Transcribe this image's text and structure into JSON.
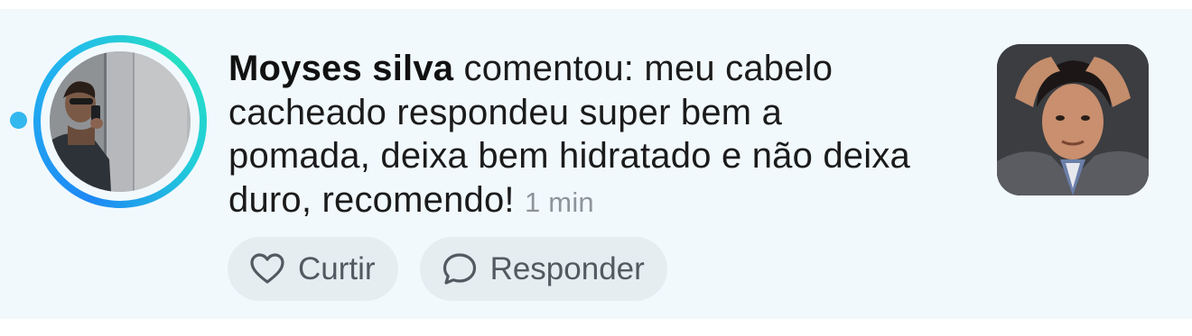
{
  "comment": {
    "author": "Moyses silva",
    "text": " comentou: meu cabelo cacheado respondeu super bem a pomada, deixa bem hidratado e não deixa duro, recomendo!",
    "time": "1 min"
  },
  "actions": {
    "like_label": "Curtir",
    "reply_label": "Responder"
  },
  "icons": {
    "like": "heart-icon",
    "reply": "speech-bubble-icon"
  },
  "colors": {
    "background": "#f1f9fd",
    "unread_dot": "#33b7ef",
    "ring_start": "#1e88f5",
    "ring_end": "#25e0c2",
    "button_bg": "#e5edf1",
    "muted_text": "#8e959a"
  }
}
